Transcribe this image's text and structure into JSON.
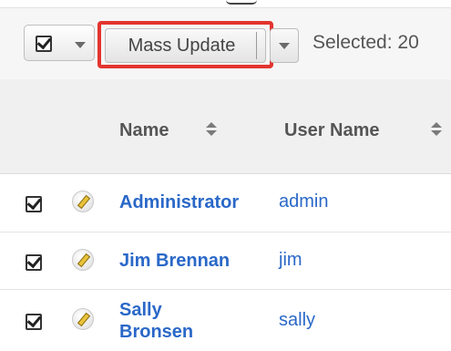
{
  "toolbar": {
    "mass_update_label": "Mass Update",
    "selected_text": "Selected: 20"
  },
  "table": {
    "columns": [
      "Name",
      "User Name"
    ],
    "rows": [
      {
        "name": "Administrator",
        "user_name": "admin",
        "checked": true
      },
      {
        "name": "Jim Brennan",
        "user_name": "jim",
        "checked": true
      },
      {
        "name_line1": "Sally",
        "name_line2": "Bronsen",
        "user_name": "sally",
        "checked": true
      }
    ]
  },
  "colors": {
    "link": "#2a68c8",
    "highlight": "#e3342f",
    "header_bg": "#f0f0f0"
  },
  "icons": [
    "checkbox-icon",
    "chevron-down-icon",
    "sort-icon",
    "pencil-icon"
  ]
}
